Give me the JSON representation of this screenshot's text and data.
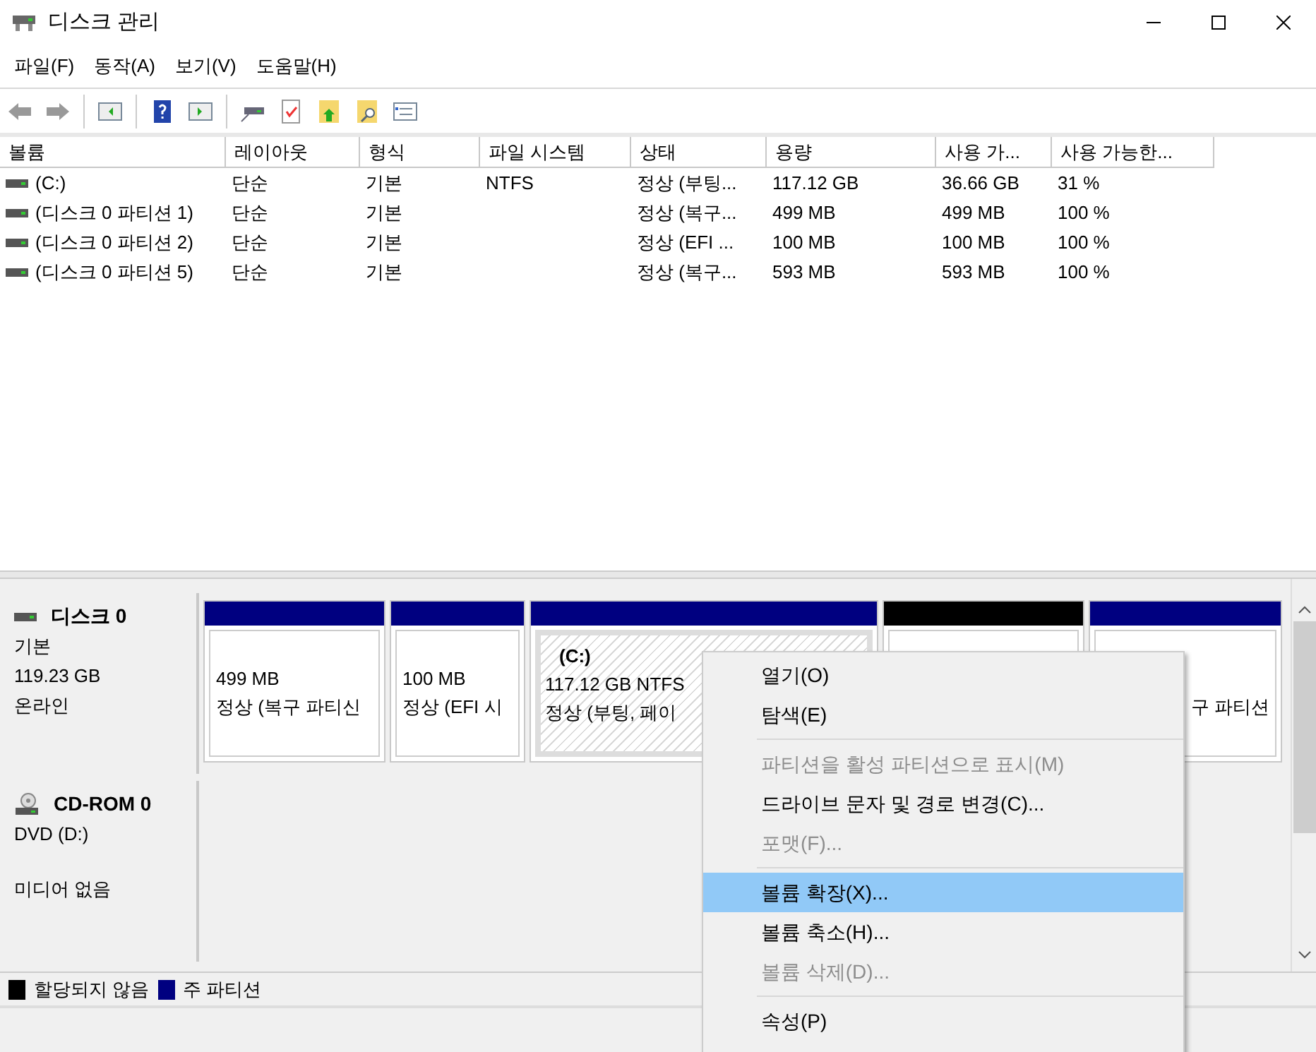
{
  "window": {
    "title": "디스크 관리"
  },
  "menu_bar": [
    "파일(F)",
    "동작(A)",
    "보기(V)",
    "도움말(H)"
  ],
  "table": {
    "columns": [
      "볼륨",
      "레이아웃",
      "형식",
      "파일 시스템",
      "상태",
      "용량",
      "사용 가...",
      "사용 가능한..."
    ],
    "rows": [
      [
        "(C:)",
        "단순",
        "기본",
        "NTFS",
        "정상 (부팅...",
        "117.12 GB",
        "36.66 GB",
        "31 %"
      ],
      [
        "(디스크 0 파티션 1)",
        "단순",
        "기본",
        "",
        "정상 (복구...",
        "499 MB",
        "499 MB",
        "100 %"
      ],
      [
        "(디스크 0 파티션 2)",
        "단순",
        "기본",
        "",
        "정상 (EFI ...",
        "100 MB",
        "100 MB",
        "100 %"
      ],
      [
        "(디스크 0 파티션 5)",
        "단순",
        "기본",
        "",
        "정상 (복구...",
        "593 MB",
        "593 MB",
        "100 %"
      ]
    ]
  },
  "disks": [
    {
      "kind": "disk",
      "name": "디스크 0",
      "lines": [
        "기본",
        "119.23 GB",
        "온라인"
      ],
      "partitions": [
        {
          "color": "#000080",
          "selected": false,
          "size": "499 MB",
          "status": "정상 (복구 파티신"
        },
        {
          "color": "#000080",
          "selected": false,
          "size": "100 MB",
          "status": "정상 (EFI 시"
        },
        {
          "color": "#000080",
          "selected": true,
          "label": "(C:)",
          "size": "117.12 GB NTFS",
          "status": "정상 (부팅, 페이"
        },
        {
          "color": "#000000",
          "selected": false
        },
        {
          "color": "#000080",
          "selected": false,
          "status": "구 파티션"
        }
      ]
    },
    {
      "kind": "cdrom",
      "name": "CD-ROM 0",
      "lines": [
        "DVD (D:)",
        "미디어 없음"
      ]
    }
  ],
  "legend": [
    {
      "label": "할당되지 않음",
      "color": "#000000"
    },
    {
      "label": "주 파티션",
      "color": "#000080"
    }
  ],
  "context_menu": {
    "groups": [
      [
        {
          "label": "열기(O)",
          "disabled": false,
          "selected": false
        },
        {
          "label": "탐색(E)",
          "disabled": false,
          "selected": false
        }
      ],
      [
        {
          "label": "파티션을 활성 파티션으로 표시(M)",
          "disabled": true,
          "selected": false
        },
        {
          "label": "드라이브 문자 및 경로 변경(C)...",
          "disabled": false,
          "selected": false
        },
        {
          "label": "포맷(F)...",
          "disabled": true,
          "selected": false
        }
      ],
      [
        {
          "label": "볼륨 확장(X)...",
          "disabled": false,
          "selected": true
        },
        {
          "label": "볼륨 축소(H)...",
          "disabled": false,
          "selected": false
        },
        {
          "label": "볼륨 삭제(D)...",
          "disabled": true,
          "selected": false
        }
      ],
      [
        {
          "label": "속성(P)",
          "disabled": false,
          "selected": false
        }
      ]
    ]
  }
}
